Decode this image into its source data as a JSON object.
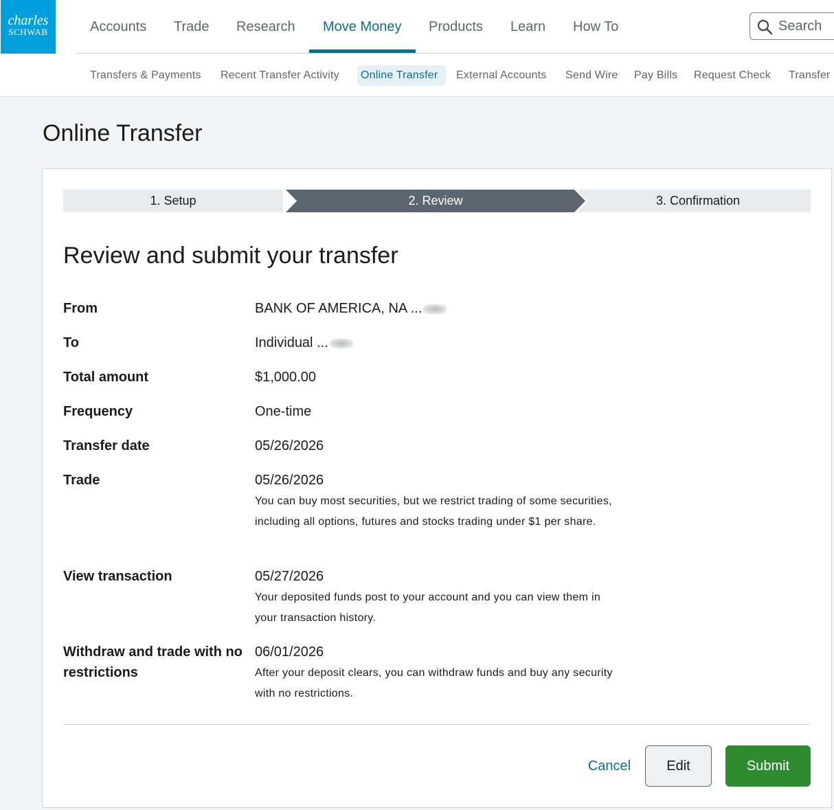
{
  "brand": {
    "line1": "charles",
    "line2": "SCHWAB",
    "color": "#00a0df"
  },
  "topnav": {
    "items": [
      {
        "label": "Accounts"
      },
      {
        "label": "Trade"
      },
      {
        "label": "Research"
      },
      {
        "label": "Move Money",
        "active": true
      },
      {
        "label": "Products"
      },
      {
        "label": "Learn"
      },
      {
        "label": "How To"
      }
    ],
    "search": {
      "label": "Search",
      "icon": "search-icon"
    }
  },
  "subnav": {
    "items": [
      {
        "label": "Transfers & Payments"
      },
      {
        "label": "Recent Transfer Activity"
      },
      {
        "label": "Online Transfer",
        "active": true
      },
      {
        "label": "External Accounts"
      },
      {
        "label": "Send Wire"
      },
      {
        "label": "Pay Bills"
      },
      {
        "label": "Request Check"
      },
      {
        "label": "Transfer"
      }
    ]
  },
  "page": {
    "title": "Online Transfer"
  },
  "steps": [
    {
      "label": "1. Setup"
    },
    {
      "label": "2. Review",
      "active": true
    },
    {
      "label": "3. Confirmation"
    }
  ],
  "review": {
    "heading": "Review and submit your transfer",
    "rows": [
      {
        "label": "From",
        "value": "BANK OF AMERICA, NA ...",
        "masked": true
      },
      {
        "label": "To",
        "value": "Individual ...",
        "masked": true
      },
      {
        "label": "Total amount",
        "value": "$1,000.00"
      },
      {
        "label": "Frequency",
        "value": "One-time"
      },
      {
        "label": "Transfer date",
        "value": "05/26/2026"
      },
      {
        "label": "Trade",
        "value": "05/26/2026",
        "note": "You can buy most securities, but we restrict trading of some securities, including all options, futures and stocks trading under $1 per share."
      },
      {
        "label": "View transaction",
        "value": "05/27/2026",
        "note": "Your deposited funds post to your account and you can view them in your transaction history."
      },
      {
        "label": "Withdraw and trade with no restrictions",
        "value": "06/01/2026",
        "note": "After your deposit clears, you can withdraw funds and buy any security with no restrictions."
      }
    ]
  },
  "actions": {
    "cancel": "Cancel",
    "edit": "Edit",
    "submit": "Submit"
  },
  "colors": {
    "accent": "#0f6e8c",
    "submit": "#2e8b2e",
    "active_step": "#5b6670"
  }
}
